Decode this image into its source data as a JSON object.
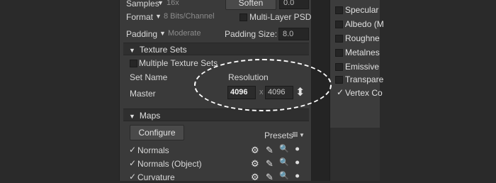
{
  "top": {
    "samples_label": "Samples",
    "samples_value": "16x",
    "soften_button": "Soften",
    "soften_value": "0.0",
    "format_label": "Format",
    "format_value": "8 Bits/Channel",
    "multilayer_label": "Multi-Layer PSD",
    "padding_label": "Padding",
    "padding_value": "Moderate",
    "padding_size_label": "Padding Size:",
    "padding_size_value": "8.0"
  },
  "texture_sets": {
    "header": "Texture Sets",
    "multiple_label": "Multiple Texture Sets",
    "col_set_name": "Set Name",
    "col_resolution": "Resolution",
    "row_name": "Master",
    "res_width": "4096",
    "res_x": "x",
    "res_height": "4096"
  },
  "maps": {
    "header": "Maps",
    "configure_button": "Configure",
    "presets_label": "Presets",
    "items": [
      {
        "label": "Normals",
        "checked": true
      },
      {
        "label": "Normals (Object)",
        "checked": true
      },
      {
        "label": "Curvature",
        "checked": true
      }
    ]
  },
  "right_panel": {
    "items": [
      {
        "label": "Specular",
        "checked": false
      },
      {
        "label": "Albedo (M",
        "checked": false
      },
      {
        "label": "Roughne",
        "checked": false
      },
      {
        "label": "Metalnes",
        "checked": false
      },
      {
        "label": "Emissive",
        "checked": false
      },
      {
        "label": "Transpare",
        "checked": false
      },
      {
        "label": "Vertex Co",
        "checked": true
      }
    ]
  },
  "glyphs": {
    "check": "✓",
    "gear": "⚙",
    "pencil": "✎",
    "search": "🔍",
    "tri_down": "▼",
    "updown": "⬍"
  },
  "colors": {
    "panel_bg": "#3a3a3a",
    "section_bg": "#2f2f2f",
    "field_bg": "#262626",
    "highlight_ellipse": "#ffffff"
  }
}
